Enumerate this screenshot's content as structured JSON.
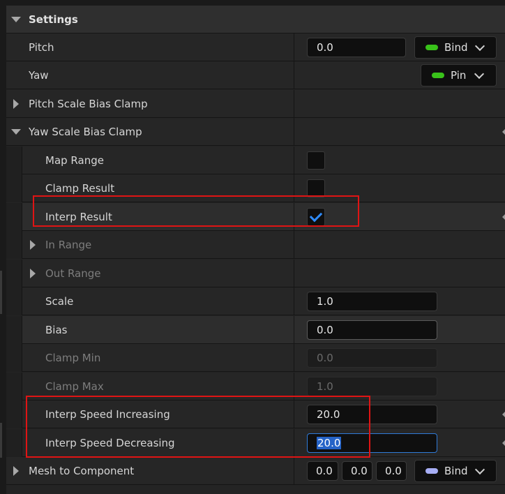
{
  "settings": {
    "header": "Settings",
    "pitch": {
      "label": "Pitch",
      "value": "0.0",
      "bind_label": "Bind",
      "bind_color": "#39c21a"
    },
    "yaw": {
      "label": "Yaw",
      "pin_label": "Pin",
      "pin_color": "#39c21a"
    },
    "pitch_scale_bias_clamp": {
      "label": "Pitch Scale Bias Clamp"
    },
    "yaw_scale_bias_clamp": {
      "label": "Yaw Scale Bias Clamp",
      "map_range": {
        "label": "Map Range",
        "checked": false
      },
      "clamp_result": {
        "label": "Clamp Result",
        "checked": false
      },
      "interp_result": {
        "label": "Interp Result",
        "checked": true
      },
      "in_range": {
        "label": "In Range"
      },
      "out_range": {
        "label": "Out Range"
      },
      "scale": {
        "label": "Scale",
        "value": "1.0"
      },
      "bias": {
        "label": "Bias",
        "value": "0.0"
      },
      "clamp_min": {
        "label": "Clamp Min",
        "value": "0.0"
      },
      "clamp_max": {
        "label": "Clamp Max",
        "value": "1.0"
      },
      "interp_speed_increasing": {
        "label": "Interp Speed Increasing",
        "value": "20.0"
      },
      "interp_speed_decreasing": {
        "label": "Interp Speed Decreasing",
        "value": "20.0"
      }
    },
    "mesh_to_component": {
      "label": "Mesh to Component",
      "x": "0.0",
      "y": "0.0",
      "z": "0.0",
      "bind_label": "Bind",
      "bind_color": "#a7aef5"
    }
  },
  "colors": {
    "highlight_box": "#e01414",
    "checkmark": "#2f8cff",
    "focus": "#2f7bd8"
  }
}
